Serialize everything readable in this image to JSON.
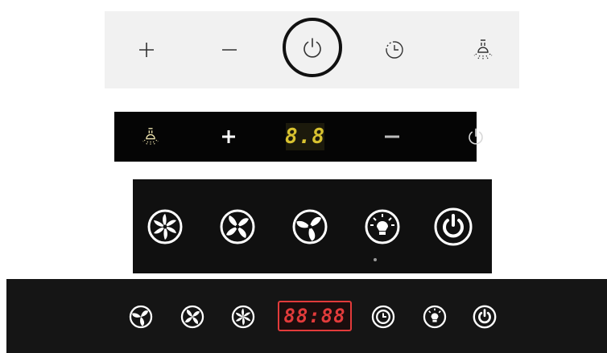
{
  "panel1": {
    "buttons": [
      "plus",
      "minus",
      "power",
      "timer",
      "light"
    ],
    "power_selected": true
  },
  "panel2": {
    "buttons": [
      "light",
      "plus",
      "display",
      "minus",
      "power"
    ],
    "display_text": "8.8",
    "display_color": "#d8c230"
  },
  "panel3": {
    "buttons": [
      "fan-speed-3",
      "fan-speed-2",
      "fan-speed-1",
      "light",
      "power"
    ]
  },
  "panel4": {
    "buttons": [
      "fan-speed-1",
      "fan-speed-2",
      "fan-speed-3",
      "display",
      "timer",
      "light",
      "power"
    ],
    "display_text": "88:88",
    "display_color": "#e23b3b"
  }
}
